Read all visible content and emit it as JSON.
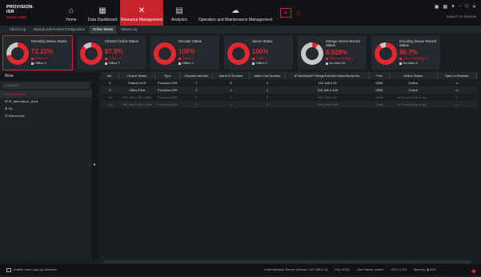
{
  "app": {
    "brand": "PROVISION-ISR",
    "subtitle": "Ocean VMS"
  },
  "nav": [
    {
      "label": "Home",
      "icon": "home-icon",
      "glyph": "⌂"
    },
    {
      "label": "Data Dashboard",
      "icon": "dashboard-icon",
      "glyph": "▦"
    },
    {
      "label": "Resource Management",
      "icon": "tools-icon",
      "glyph": "✕",
      "active": true
    },
    {
      "label": "Analytics",
      "icon": "analytics-icon",
      "glyph": "▤"
    },
    {
      "label": "Operation and Maintenance Management",
      "icon": "cloud-icon",
      "glyph": "☁"
    }
  ],
  "window": {
    "datetime": "2024-07-11 15:28:08"
  },
  "tabs": [
    "Check Log",
    "Backup and Restore Configuration",
    "Online Status",
    "Status Log"
  ],
  "active_tab": "Online Status",
  "cards": [
    {
      "title": "Encoding Device Status",
      "pct": "72.22%",
      "online": "Online 13",
      "offline": "Offline 5",
      "selected": true
    },
    {
      "title": "Channel Online Status",
      "pct": "87.5%",
      "online": "Online 49",
      "offline": "Offline 7"
    },
    {
      "title": "Decoder Status",
      "pct": "100%",
      "online": "Online 1",
      "offline": "Offline 0"
    },
    {
      "title": "Server Status",
      "pct": "100%",
      "online": "Online 3",
      "offline": "Offline 0"
    },
    {
      "title": "Storage Server Record Status",
      "pct": "8.929%",
      "online": "Video recording 5",
      "offline": "No video 51"
    },
    {
      "title": "Encoding Device Record Status",
      "pct": "90.7%",
      "online": "Video recording 39",
      "offline": "No video 4"
    }
  ],
  "area": {
    "header": "Area",
    "search_placeholder": "Search",
    "items": [
      "Default Area",
      "IR_attendance_Area",
      "SA",
      "Warehouse"
    ]
  },
  "table": {
    "columns": [
      "No.",
      "Device Name",
      "Type",
      "Channel Number",
      "Alarm In Number",
      "Alarm Out Number",
      "IP Address/IP Range/Domain Name/Serial No.",
      "Port",
      "Online Status",
      "Open in Browser"
    ],
    "rows": [
      [
        "2",
        "Shahar NVR",
        "Provision-ISR",
        "7",
        "6",
        "4",
        "192.168.0.50",
        "6036",
        "Online",
        "▭"
      ],
      [
        "3",
        "Office DDA",
        "Provision-ISR",
        "1",
        "1",
        "1",
        "192.168.0.128",
        "9008",
        "Online",
        "▭"
      ],
      [
        "14",
        "192.168.0.111_9008",
        "Provision-ISR",
        "0",
        "0",
        "0",
        "192.168.0.111",
        "9008",
        "● The account or pa...",
        "▭"
      ],
      [
        "15",
        "192.168.0.246_9008",
        "Provision-ISR",
        "0",
        "0",
        "0",
        "192.168.0.246",
        "9008",
        "● The account or pa...",
        "▭"
      ]
    ]
  },
  "status": {
    "alarm_popup": "Enable alarm pop-up windows",
    "auth_server": "Authentication Server Address: 192.168.0.16",
    "port": "Port: 6100",
    "user": "User Name: admin",
    "cpu": "CPU: ▯ 9%",
    "memory": "Memory: ▮ 83%"
  },
  "colors": {
    "accent": "#d1242f",
    "online": "#e4262f",
    "offline": "#c8c8c8"
  }
}
